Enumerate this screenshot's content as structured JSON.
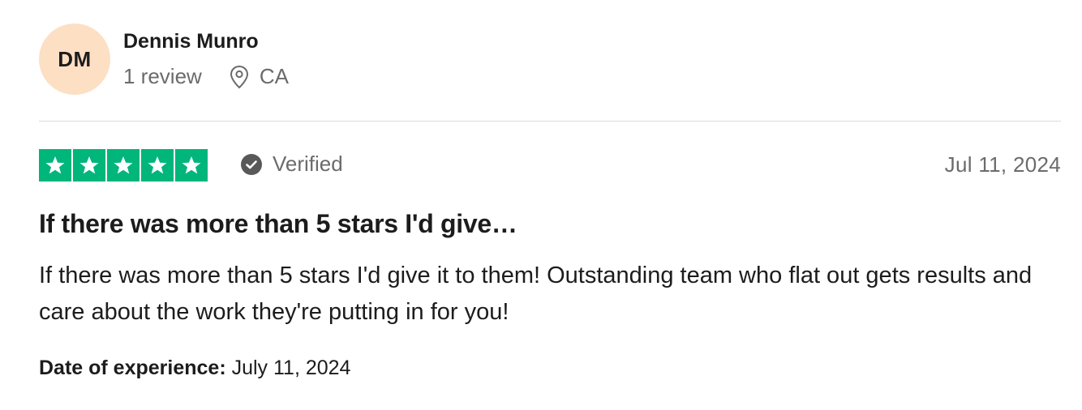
{
  "reviewer": {
    "initials": "DM",
    "name": "Dennis Munro",
    "review_count": "1 review",
    "location": "CA",
    "avatar_color": "#fddfc4"
  },
  "review": {
    "rating": 5,
    "max_rating": 5,
    "star_color": "#00b67a",
    "verified_label": "Verified",
    "date": "Jul 11, 2024",
    "title": "If there was more than 5 stars I'd give…",
    "body": "If there was more than 5 stars I'd give it to them! Outstanding team who flat out gets results and care about the work they're putting in for you!",
    "experience_label": "Date of experience:",
    "experience_date": "July 11, 2024"
  },
  "icons": {
    "location": "location-pin-icon",
    "verified": "check-circle-icon",
    "star": "star-icon"
  }
}
